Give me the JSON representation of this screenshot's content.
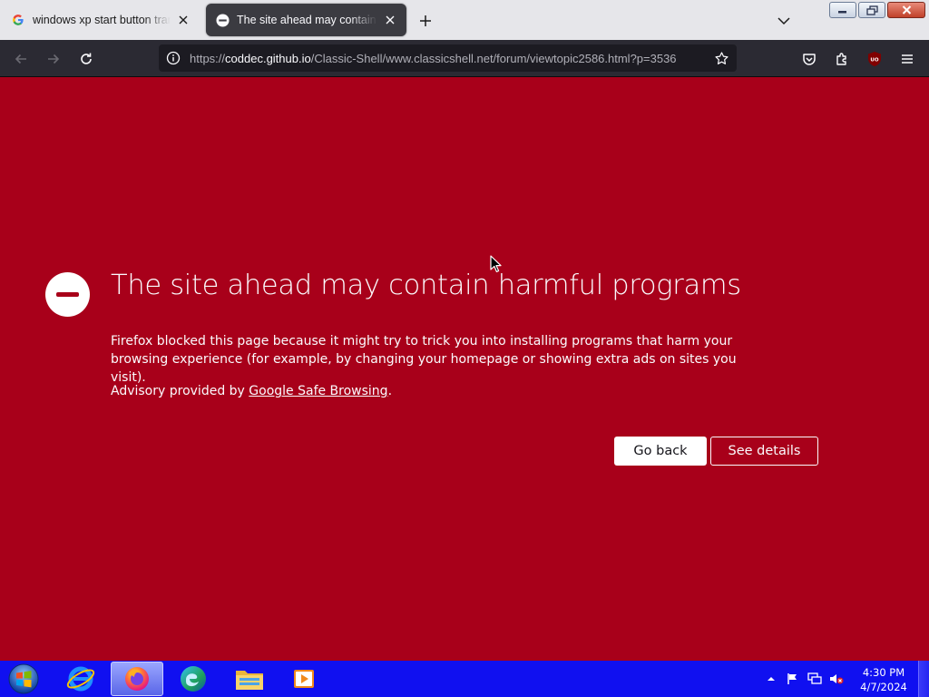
{
  "browser": {
    "tabs": [
      {
        "title": "windows xp start button transparent - Google Search",
        "favicon": "google-icon",
        "active": false
      },
      {
        "title": "The site ahead may contain harmful programs",
        "favicon": "blocked-icon",
        "active": true
      }
    ],
    "url": {
      "scheme": "https://",
      "host": "coddec.github.io",
      "path": "/Classic-Shell/www.classicshell.net/forum/viewtopic2586.html?p=3536"
    },
    "toolbar_icons": [
      "back-icon",
      "forward-icon",
      "reload-icon",
      "info-icon",
      "star-icon",
      "pocket-icon",
      "extensions-icon",
      "ublock-icon",
      "menu-icon"
    ],
    "ublock_label": "UO"
  },
  "error_page": {
    "title": "The site ahead may contain harmful programs",
    "description": "Firefox blocked this page because it might try to trick you into installing programs that harm your browsing experience (for example, by changing your homepage or showing extra ads on sites you visit).",
    "advisory_prefix": "Advisory provided by ",
    "advisory_link": "Google Safe Browsing",
    "advisory_suffix": ".",
    "go_back_label": "Go back",
    "see_details_label": "See details",
    "background_color": "#a8001a"
  },
  "taskbar": {
    "apps": [
      "internet-explorer-icon",
      "firefox-icon",
      "edge-icon",
      "file-explorer-icon",
      "media-player-icon"
    ],
    "tray_icons": [
      "show-hidden-icons",
      "action-center-flag-icon",
      "network-icon",
      "volume-muted-icon"
    ],
    "time": "4:30 PM",
    "date": "4/7/2024",
    "color": "#1010f0"
  }
}
